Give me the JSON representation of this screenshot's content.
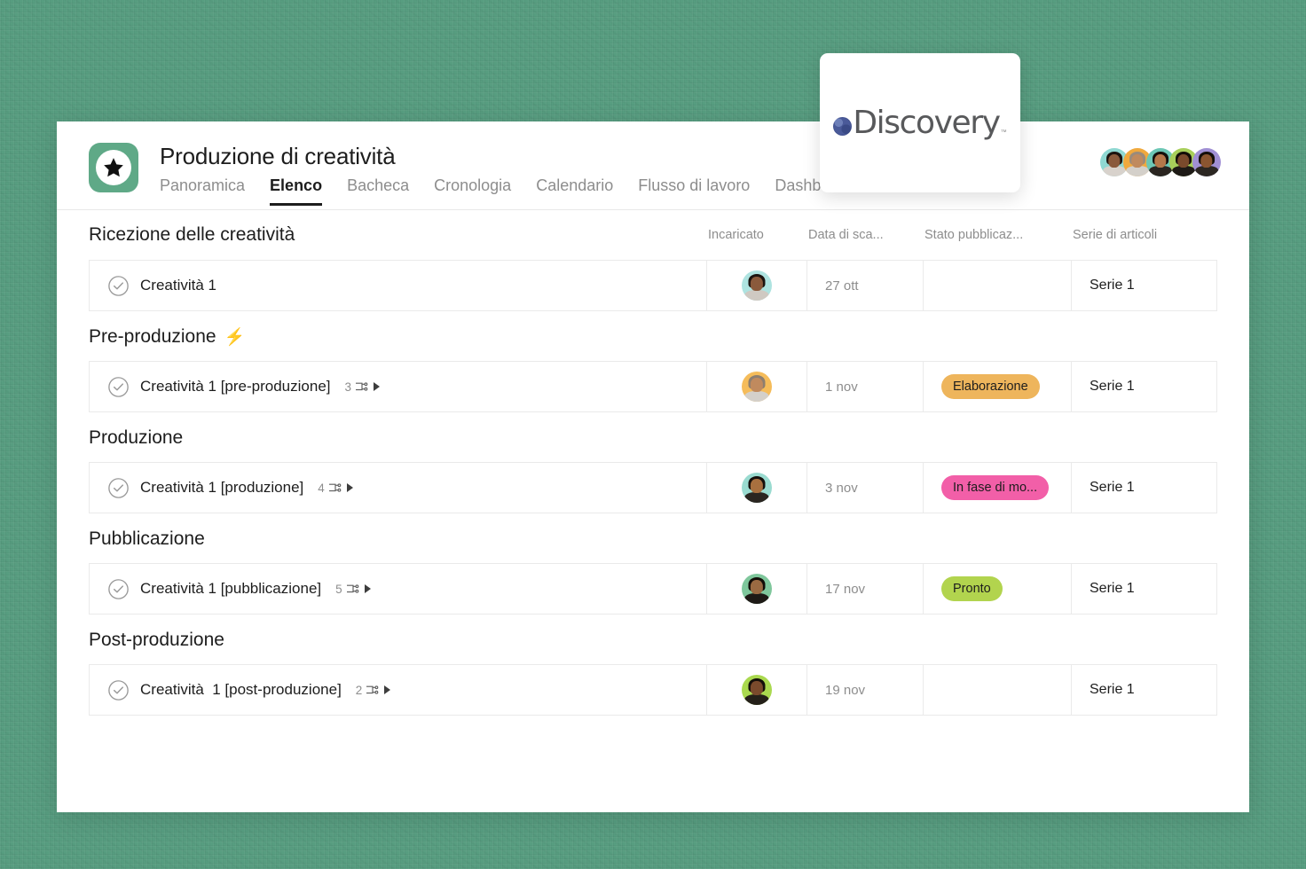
{
  "background": {
    "color": "#579d80"
  },
  "header": {
    "title": "Produzione di creatività",
    "icon_name": "star-badge-icon",
    "tabs": [
      {
        "label": "Panoramica",
        "active": false
      },
      {
        "label": "Elenco",
        "active": true
      },
      {
        "label": "Bacheca",
        "active": false
      },
      {
        "label": "Cronologia",
        "active": false
      },
      {
        "label": "Calendario",
        "active": false
      },
      {
        "label": "Flusso di lavoro",
        "active": false
      },
      {
        "label": "Dashboard",
        "active": false
      }
    ],
    "members": [
      {
        "name": "member-1",
        "bg": "#8fd8d2",
        "skin": "#8a5a3c",
        "hair": "#1c1410",
        "shirt": "#d8d2cc"
      },
      {
        "name": "member-2",
        "bg": "#f0a93e",
        "skin": "#c08a5e",
        "hair": "#9a8b7c",
        "shirt": "#d4d0ca"
      },
      {
        "name": "member-3",
        "bg": "#6cc7b5",
        "skin": "#b5784a",
        "hair": "#15100c",
        "shirt": "#2a2520"
      },
      {
        "name": "member-4",
        "bg": "#a8cf5a",
        "skin": "#7a4a2c",
        "hair": "#120d08",
        "shirt": "#1e1a16"
      },
      {
        "name": "member-5",
        "bg": "#a08fd4",
        "skin": "#8a5530",
        "hair": "#140f0a",
        "shirt": "#2c2722"
      }
    ]
  },
  "columns": {
    "assignee": "Incaricato",
    "due_date": "Data di sca...",
    "publish_status": "Stato pubblicaz...",
    "article_series": "Serie di articoli"
  },
  "sections": [
    {
      "title": "Ricezione delle creatività",
      "badge_icon": "",
      "tasks": [
        {
          "name": "Creatività 1",
          "subtask_count": "",
          "assignee": {
            "name": "avatar-assignee-1",
            "bg": "#aee3e0",
            "skin": "#8a5a3c",
            "hair": "#1c1410",
            "shirt": "#cfc9c2"
          },
          "date": "27 ott",
          "status": {
            "label": "",
            "color": ""
          },
          "series": "Serie 1"
        }
      ]
    },
    {
      "title": "Pre-produzione",
      "badge_icon": "⚡",
      "tasks": [
        {
          "name": "Creatività 1 [pre-produzione]",
          "subtask_count": "3",
          "assignee": {
            "name": "avatar-assignee-2",
            "bg": "#f5bc5a",
            "skin": "#c08a5e",
            "hair": "#8d7e6f",
            "shirt": "#d4d0ca"
          },
          "date": "1 nov",
          "status": {
            "label": "Elaborazione",
            "color": "#eeb55c"
          },
          "series": "Serie 1"
        }
      ]
    },
    {
      "title": "Produzione",
      "badge_icon": "",
      "tasks": [
        {
          "name": "Creatività 1 [produzione]",
          "subtask_count": "4",
          "assignee": {
            "name": "avatar-assignee-3",
            "bg": "#9adbd0",
            "skin": "#a8703f",
            "hair": "#15100c",
            "shirt": "#2a2520"
          },
          "date": "3 nov",
          "status": {
            "label": "In fase di mo...",
            "color": "#f25fa8"
          },
          "series": "Serie 1"
        }
      ]
    },
    {
      "title": "Pubblicazione",
      "badge_icon": "",
      "tasks": [
        {
          "name": "Creatività 1 [pubblicazione]",
          "subtask_count": "5",
          "assignee": {
            "name": "avatar-assignee-4",
            "bg": "#7fc79c",
            "skin": "#9a6a42",
            "hair": "#120d08",
            "shirt": "#1e1a16"
          },
          "date": "17 nov",
          "status": {
            "label": "Pronto",
            "color": "#b2d44e"
          },
          "series": "Serie 1"
        }
      ]
    },
    {
      "title": "Post-produzione",
      "badge_icon": "",
      "tasks": [
        {
          "name": "Creatività  1 [post-produzione]",
          "subtask_count": "2",
          "assignee": {
            "name": "avatar-assignee-5",
            "bg": "#aad94f",
            "skin": "#7a4a2c",
            "hair": "#140f0a",
            "shirt": "#242019"
          },
          "date": "19 nov",
          "status": {
            "label": "",
            "color": ""
          },
          "series": "Serie 1"
        }
      ]
    }
  ],
  "overlay": {
    "brand_word": "Discovery",
    "trademark": "™",
    "globe_icon": "globe-icon"
  }
}
